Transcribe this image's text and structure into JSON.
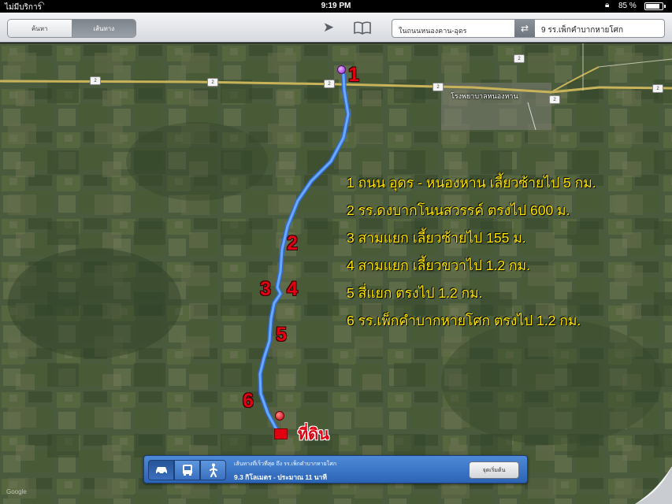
{
  "status_bar": {
    "carrier": "ไม่มีบริการ",
    "time": "9:19 PM",
    "battery": "85 %"
  },
  "toolbar": {
    "segments": [
      "ค้นหา",
      "เส้นทาง"
    ],
    "selected_segment": "เส้นทาง",
    "route_start": "ในถนนหนองคาน-อุดร",
    "route_end": "9 รร.เพ็กคำบากหายโศก"
  },
  "map": {
    "road_badges": [
      "2",
      "2",
      "2",
      "2",
      "2",
      "2",
      "2"
    ],
    "place_label": "โรงพยาบาลหนองหาน",
    "step_numbers": [
      "1",
      "2",
      "3",
      "4",
      "5",
      "6"
    ],
    "destination_label": "ที่ดิน",
    "directions": [
      "1 ถนน อุดร - หนองหาน เลี้ยวซ้ายไป 5 กม.",
      "2 รร.ดงบากโนนสวรรค์ ตรงไป 600 ม.",
      "3 สามแยก เลี้ยวซ้ายไป 155 ม.",
      "4 สามแยก เลี้ยวขวาไป 1.2 กม.",
      "5 สี่แยก ตรงไป 1.2 กม.",
      "6 รร.เพ็กคำบากหายโศก ตรงไป 1.2 กม."
    ],
    "route_color": "#6aa8ff",
    "direction_text_color": "#ffe600",
    "step_number_color": "#e00010"
  },
  "info_bar": {
    "modes": [
      "car-icon",
      "bus-icon",
      "walk-icon"
    ],
    "route_text": "เส้นทางที่เร็วที่สุด ถึง รร.เพ็กคำบากหายโศก",
    "summary": "9.3 กิโลเมตร - ประมาณ 11 นาที",
    "start_label": "จุดเริ่มต้น"
  },
  "watermark": "Google"
}
